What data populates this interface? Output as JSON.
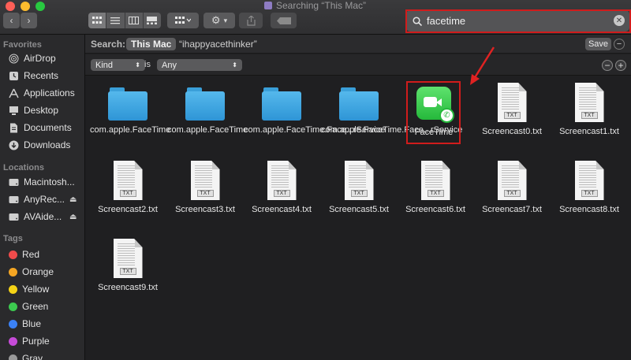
{
  "window": {
    "title": "Searching “This Mac”"
  },
  "toolbar": {
    "back_icon": "chevron-left-icon",
    "forward_icon": "chevron-right-icon",
    "views": [
      "icon-view",
      "list-view",
      "column-view",
      "gallery-view"
    ],
    "search_value": "facetime"
  },
  "sidebar": {
    "favorites_heading": "Favorites",
    "favorites": [
      {
        "label": "AirDrop",
        "icon": "airdrop-icon"
      },
      {
        "label": "Recents",
        "icon": "clock-icon"
      },
      {
        "label": "Applications",
        "icon": "applications-icon"
      },
      {
        "label": "Desktop",
        "icon": "desktop-icon"
      },
      {
        "label": "Documents",
        "icon": "document-icon"
      },
      {
        "label": "Downloads",
        "icon": "download-icon"
      }
    ],
    "locations_heading": "Locations",
    "locations": [
      {
        "label": "Macintosh...",
        "icon": "disk-icon"
      },
      {
        "label": "AnyRec...",
        "icon": "disk-icon"
      },
      {
        "label": "AVAide...",
        "icon": "disk-icon"
      }
    ],
    "tags_heading": "Tags",
    "tags": [
      {
        "label": "Red",
        "color": "#ef4b4b"
      },
      {
        "label": "Orange",
        "color": "#f5a623"
      },
      {
        "label": "Yellow",
        "color": "#f5d316"
      },
      {
        "label": "Green",
        "color": "#3cc94f"
      },
      {
        "label": "Blue",
        "color": "#3b82f6"
      },
      {
        "label": "Purple",
        "color": "#c64bd8"
      },
      {
        "label": "Gray",
        "color": "#9a9a9a"
      }
    ]
  },
  "searchbar": {
    "label": "Search:",
    "scope_active": "This Mac",
    "scope_other": "“ihappyacethinker”",
    "save_label": "Save"
  },
  "criteria": {
    "kind": "Kind",
    "operator": "is",
    "value": "Any"
  },
  "files": [
    {
      "name": "com.apple.FaceTime",
      "type": "folder"
    },
    {
      "name": "com.apple.FaceTime",
      "type": "folder"
    },
    {
      "name": "com.apple.FaceTime.Face...rService",
      "type": "folder"
    },
    {
      "name": "com.apple.FaceTime.Face...rService",
      "type": "folder"
    },
    {
      "name": "FaceTime",
      "type": "app"
    },
    {
      "name": "Screencast0.txt",
      "type": "txt"
    },
    {
      "name": "Screencast1.txt",
      "type": "txt"
    },
    {
      "name": "Screencast2.txt",
      "type": "txt"
    },
    {
      "name": "Screencast3.txt",
      "type": "txt"
    },
    {
      "name": "Screencast4.txt",
      "type": "txt"
    },
    {
      "name": "Screencast5.txt",
      "type": "txt"
    },
    {
      "name": "Screencast6.txt",
      "type": "txt"
    },
    {
      "name": "Screencast7.txt",
      "type": "txt"
    },
    {
      "name": "Screencast8.txt",
      "type": "txt"
    },
    {
      "name": "Screencast9.txt",
      "type": "txt"
    }
  ],
  "file_type_tag": "TXT",
  "highlight_color": "#d01c1c"
}
